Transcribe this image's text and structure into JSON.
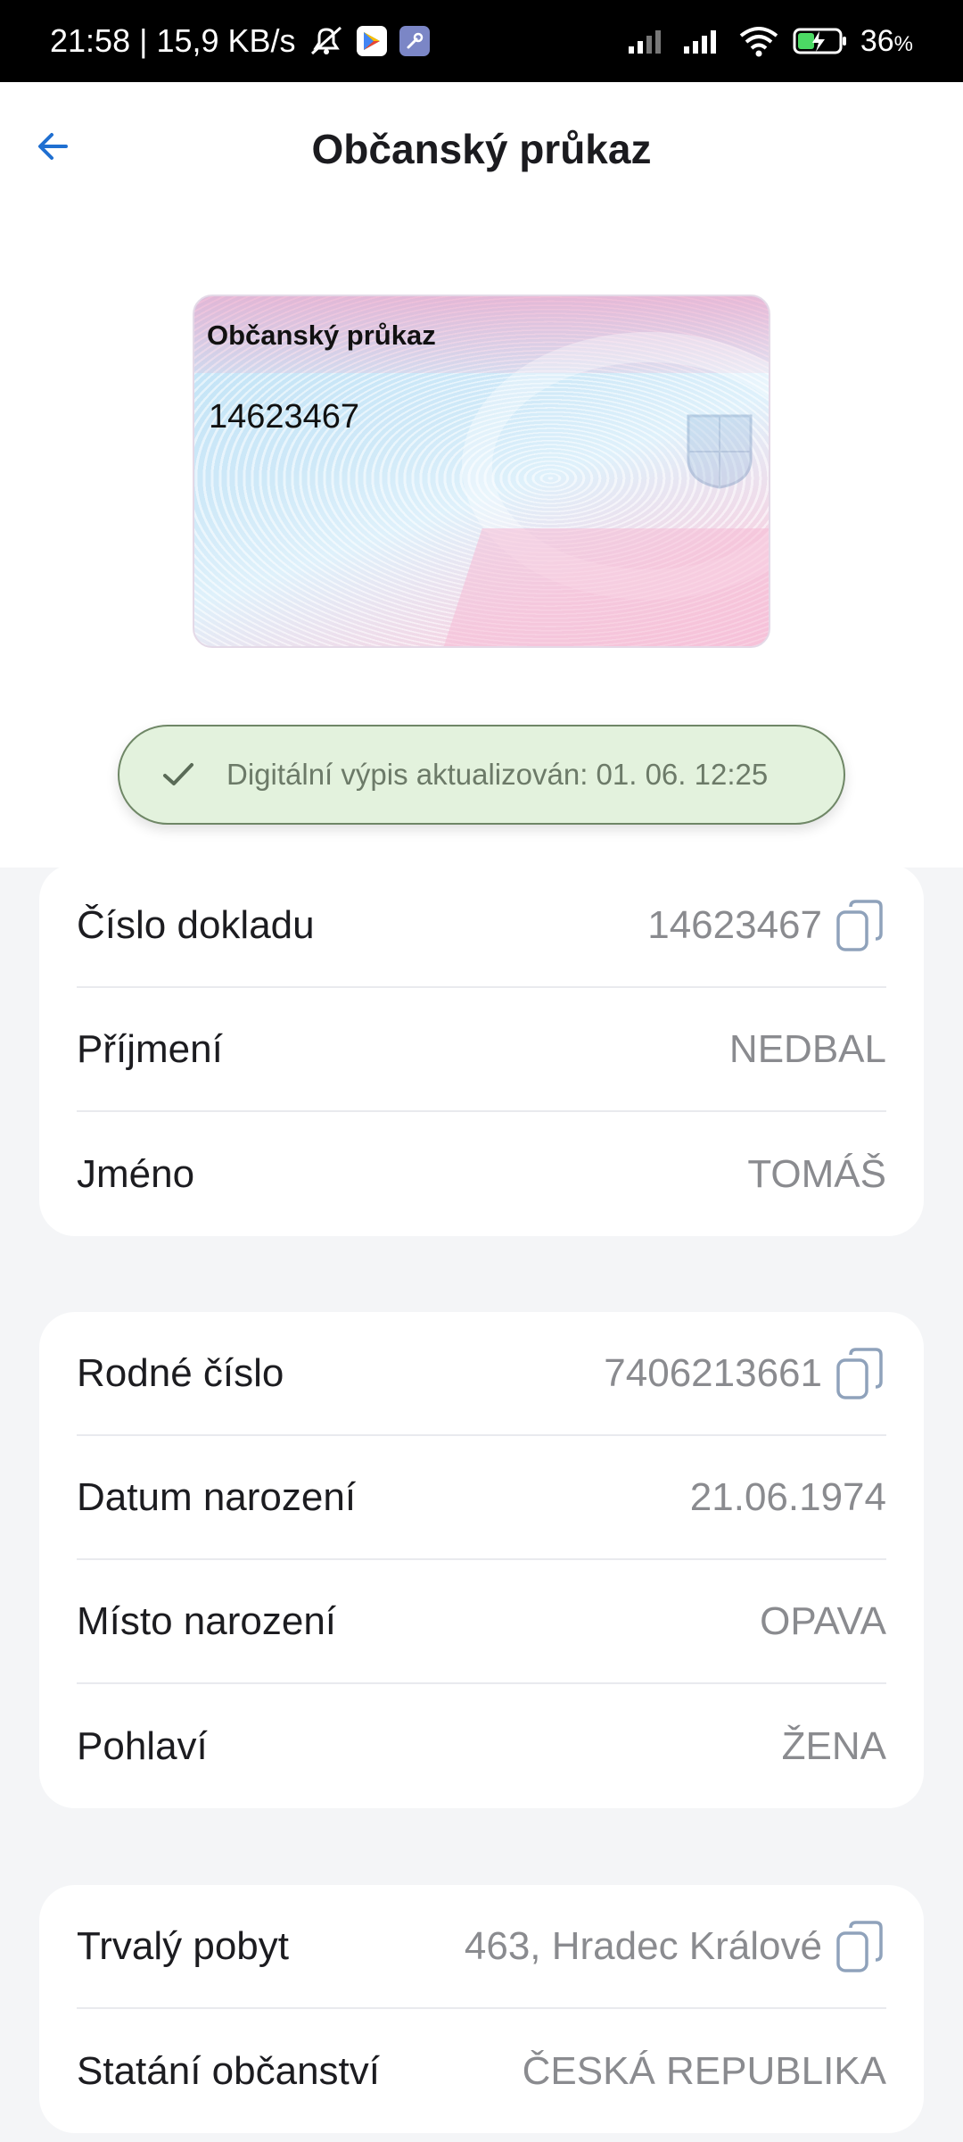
{
  "status_bar": {
    "time_speed": "21:58 | 15,9 KB/s",
    "battery_percent": "36",
    "battery_unit": "%",
    "icons": [
      "mute-icon",
      "play-store-icon",
      "tools-icon",
      "signal-icon",
      "signal-icon",
      "wifi-icon",
      "battery-charging-icon"
    ]
  },
  "header": {
    "title": "Občanský průkaz",
    "back_icon": "arrow-left-icon"
  },
  "card_preview": {
    "title": "Občanský průkaz",
    "number": "14623467"
  },
  "toast": {
    "icon": "check-icon",
    "text": "Digitální výpis aktualizován: 01. 06. 12:25"
  },
  "sections": {
    "document": {
      "rows": [
        {
          "label": "Číslo dokladu",
          "value": "14623467",
          "copy": true
        },
        {
          "label": "Příjmení",
          "value": "NEDBAL",
          "copy": false
        },
        {
          "label": "Jméno",
          "value": "TOMÁŠ",
          "copy": false
        }
      ]
    },
    "personal": {
      "rows": [
        {
          "label": "Rodné číslo",
          "value": "7406213661",
          "copy": true
        },
        {
          "label": "Datum narození",
          "value": "21.06.1974",
          "copy": false
        },
        {
          "label": "Místo narození",
          "value": "OPAVA",
          "copy": false
        },
        {
          "label": "Pohlaví",
          "value": "ŽENA",
          "copy": false
        }
      ]
    },
    "address": {
      "rows": [
        {
          "label": "Trvalý pobyt",
          "value": "463, Hradec Králové",
          "copy": true
        },
        {
          "label": "Statání občanství",
          "value": "ČESKÁ REPUBLIKA",
          "copy": false
        }
      ]
    }
  },
  "colors": {
    "accent": "#1f6fd1",
    "toast_bg": "#e3f2dd",
    "value_text": "#8a8b8f"
  }
}
